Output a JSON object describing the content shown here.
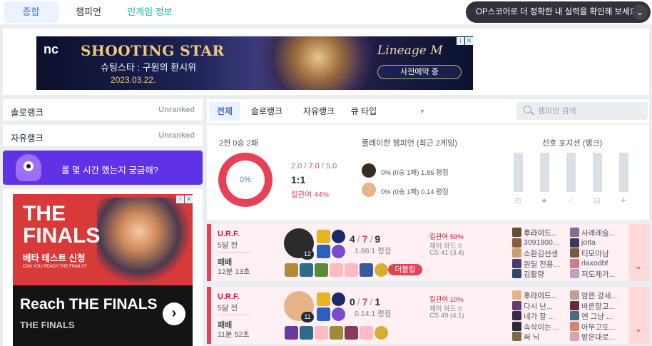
{
  "nav": {
    "tabs": [
      "종합",
      "챔피언",
      "인게임 정보"
    ],
    "op_button": "OP스코어로 더 정확한 내 실력을 확인해 보세요",
    "op_button_icon": "chevron-down-icon"
  },
  "ad_top": {
    "brand": "nc",
    "title": "SHOOTING STAR",
    "subtitle": "슈팅스타 : 구원의 환시위",
    "date": "2023.03.22.",
    "game": "Lineage M",
    "cta": "사전예약 중"
  },
  "ranks": [
    {
      "label": "솔로랭크",
      "value": "Unranked"
    },
    {
      "label": "자유랭크",
      "value": "Unranked"
    }
  ],
  "promo": {
    "text": "롤 몇 시간 했는지 궁금해?"
  },
  "ad_left": {
    "headline": "THE FINALS",
    "beta": "베타 테스트 신청",
    "small": "CAN YOU REACH THE FINALS?",
    "title": "Reach THE FINALS",
    "subtitle": "THE FINALS"
  },
  "filter": {
    "tabs": [
      "전체",
      "솔로랭크",
      "자유랭크",
      "큐 타입"
    ],
    "search_placeholder": "챔피언 검색"
  },
  "summary": {
    "record": "2전 0승 2패",
    "winrate": "0%",
    "kda_k": "2.0",
    "kda_d": "7.0",
    "kda_a": "5.0",
    "ratio": "1:1",
    "kill_participation": "킬관여 44%",
    "played_title": "플레이한 챔피언 (최근 2게임)",
    "champions": [
      {
        "text": "0% (0승 1패)  1.86 평점",
        "color": "#3d2a1e"
      },
      {
        "text": "0% (0승 1패)  0.14 평점",
        "color": "#e7b48a"
      }
    ],
    "position_title": "선호 포지션 (랭크)",
    "positions": [
      "top-icon",
      "jungle-icon",
      "mid-icon",
      "adc-icon",
      "support-icon"
    ]
  },
  "matches": [
    {
      "mode": "U.R.F.",
      "ago": "5달 전",
      "result": "패배",
      "duration": "12분 13초",
      "level": "12",
      "k": "4",
      "d": "7",
      "a": "9",
      "ratio": "1.86:1 평점",
      "badge": "더블킬",
      "kp": "킬관여 59%",
      "wards": "제어 와드 0",
      "cs": "CS 41 (3.4)",
      "champ_color": "#2b2b2b",
      "team1": [
        {
          "name": "후라이드...",
          "color": "#6b4a30"
        },
        {
          "name": "3091900...",
          "color": "#8a5a3a"
        },
        {
          "name": "소환김선생",
          "color": "#c4a070"
        },
        {
          "name": "원딜 전용...",
          "color": "#4a3a70"
        },
        {
          "name": "김활량",
          "color": "#2a4a70"
        }
      ],
      "team2": [
        {
          "name": "사례레슬...",
          "color": "#8a6a9a"
        },
        {
          "name": "jotta",
          "color": "#3a3a5a"
        },
        {
          "name": "티모마남",
          "color": "#7a5a3a"
        },
        {
          "name": "rlaxodbf",
          "color": "#d07a8a"
        },
        {
          "name": "저도제가...",
          "color": "#c0a0c0"
        }
      ]
    },
    {
      "mode": "U.R.F.",
      "ago": "5달 전",
      "result": "패배",
      "duration": "11분 52초",
      "level": "11",
      "k": "0",
      "d": "7",
      "a": "1",
      "ratio": "0.14:1 평점",
      "kp": "킬관여 10%",
      "wards": "제어 와드 0",
      "cs": "CS 49 (4.1)",
      "champ_color": "#e7b48a",
      "team1": [
        {
          "name": "후라이드...",
          "color": "#e7b48a"
        },
        {
          "name": "다시 난...",
          "color": "#6a3a6a"
        },
        {
          "name": "네가 잘 ...",
          "color": "#3a2a4a"
        },
        {
          "name": "속삭이는 ...",
          "color": "#2a2a3a"
        },
        {
          "name": "써 닉",
          "color": "#7a6a4a"
        }
      ],
      "team2": [
        {
          "name": "암쯘 강세...",
          "color": "#c0a090"
        },
        {
          "name": "바른말고...",
          "color": "#6a2a3a"
        },
        {
          "name": "앤 그냥 ...",
          "color": "#4a6a8a"
        },
        {
          "name": "아무고또...",
          "color": "#d08a6a"
        },
        {
          "name": "받은대로...",
          "color": "#e0a0b0"
        }
      ]
    }
  ]
}
